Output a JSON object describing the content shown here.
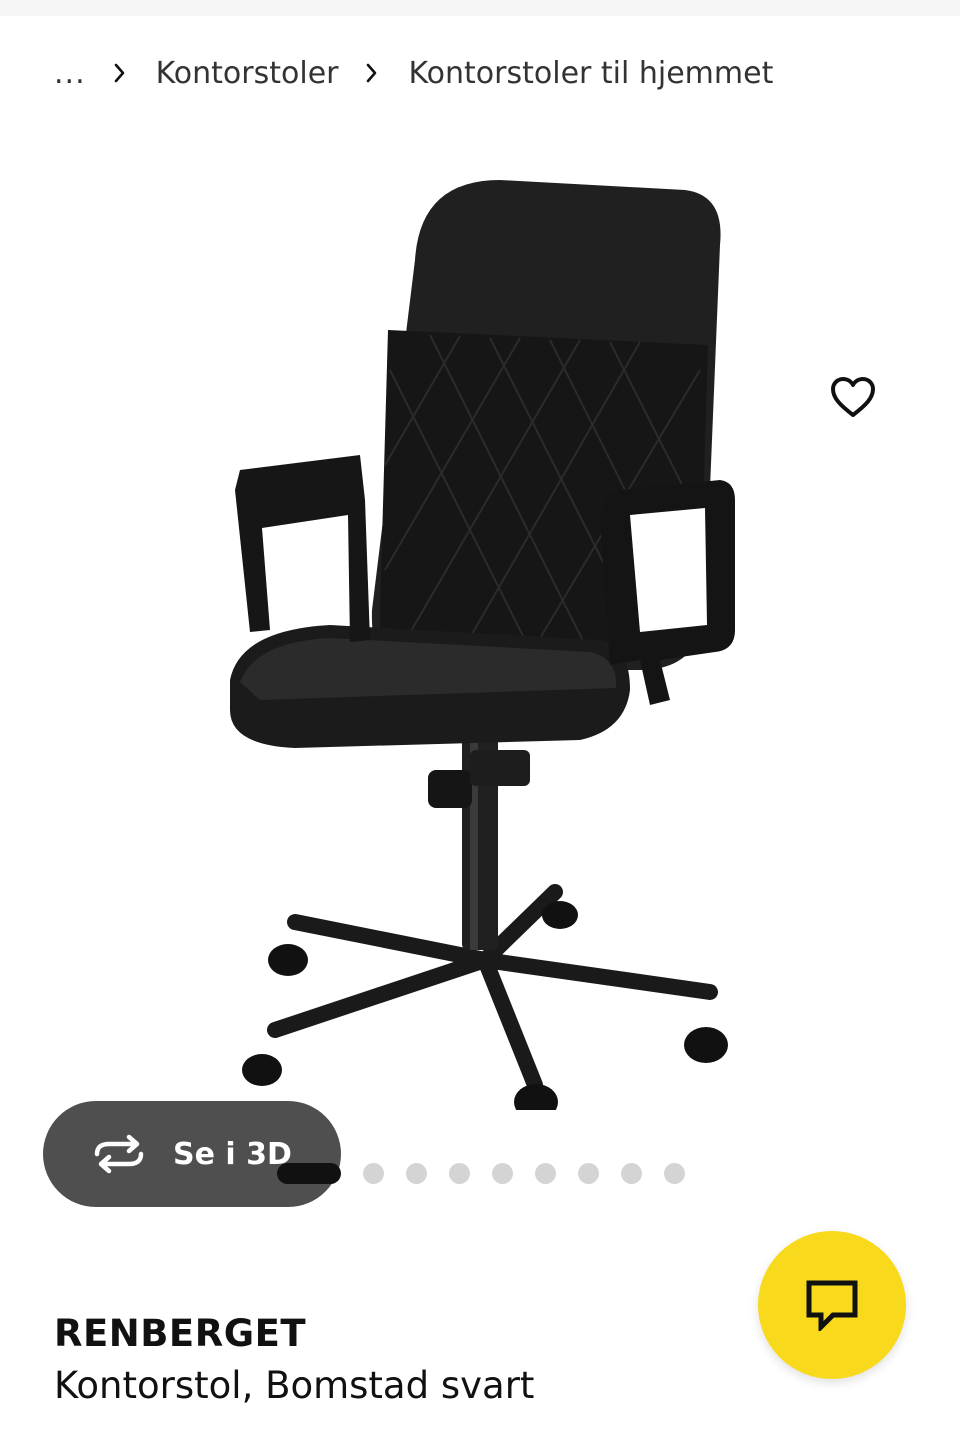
{
  "breadcrumb": {
    "ellipsis": "...",
    "items": [
      "Kontorstoler",
      "Kontorstoler til hjemmet"
    ]
  },
  "icons": {
    "separator": "chevron-right-icon",
    "favorite": "heart-icon",
    "view3d": "rotate-3d-icon",
    "chat": "chat-bubble-icon"
  },
  "gallery": {
    "view3d_label": "Se i 3D",
    "image_count": 9,
    "active_index": 0
  },
  "product": {
    "name": "RENBERGET",
    "description": "Kontorstol, Bomstad svart"
  },
  "colors": {
    "accent": "#f8d91c",
    "dark": "#111111",
    "dot_inactive": "#d4d4d4",
    "view3d_bg": "#404040"
  }
}
